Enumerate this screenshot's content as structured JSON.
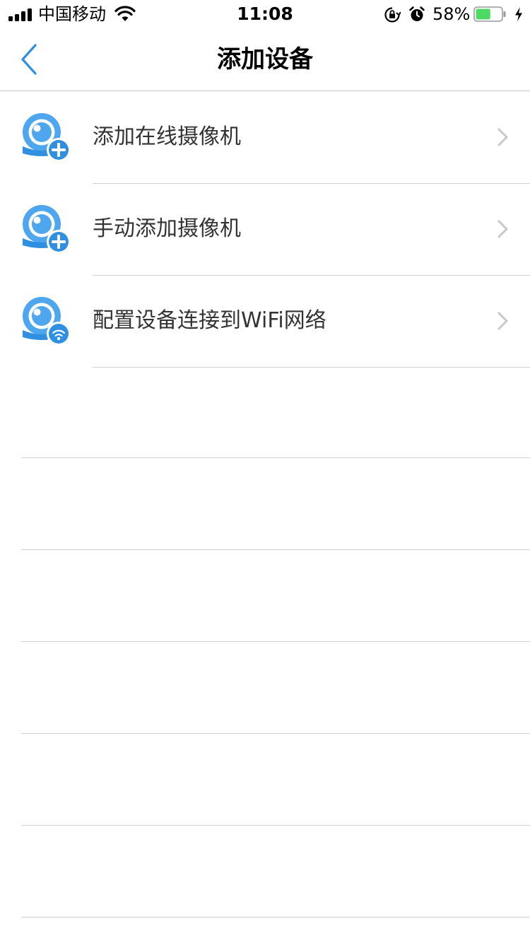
{
  "status_bar": {
    "carrier": "中国移动",
    "time": "11:08",
    "battery_percent": "58%",
    "battery_level": 0.58,
    "icons": [
      "signal-icon",
      "wifi-icon",
      "orientation-lock-icon",
      "alarm-icon",
      "battery-icon",
      "charging-icon"
    ]
  },
  "nav": {
    "title": "添加设备",
    "back_icon": "chevron-left-icon"
  },
  "list": {
    "items": [
      {
        "label": "添加在线摄像机",
        "icon": "camera-add-icon"
      },
      {
        "label": "手动添加摄像机",
        "icon": "camera-add-icon"
      },
      {
        "label": "配置设备连接到WiFi网络",
        "icon": "camera-wifi-icon"
      }
    ]
  },
  "colors": {
    "accent": "#2f8fe0",
    "icon_light": "#4ea6ee",
    "divider": "#d1d1d6",
    "chevron": "#c7c7cc",
    "battery": "#4cd964"
  }
}
